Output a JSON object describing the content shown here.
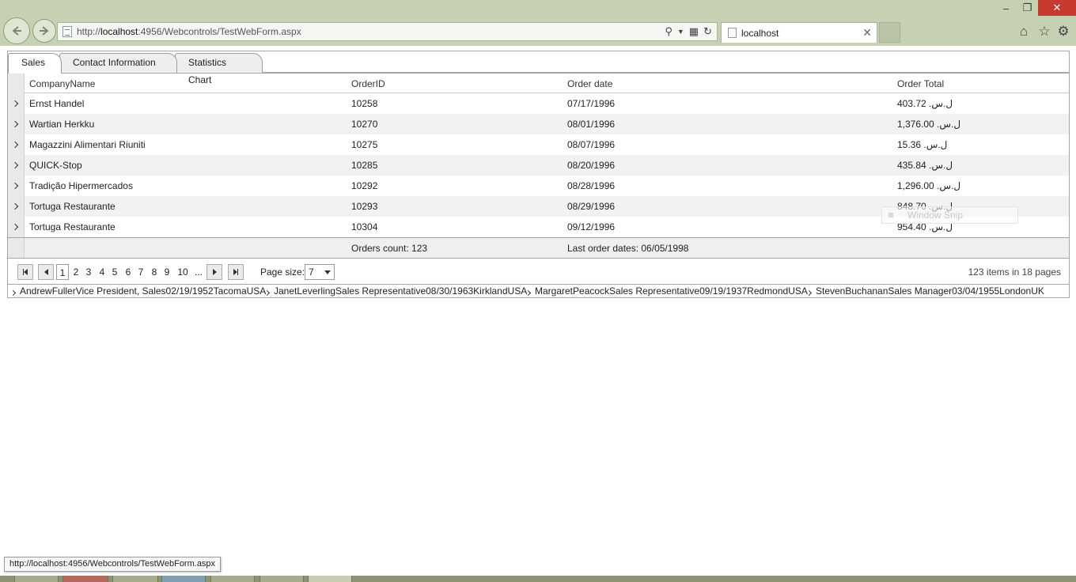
{
  "browser": {
    "url_prefix": "http://",
    "url_host": "localhost",
    "url_rest": ":4956/Webcontrols/TestWebForm.aspx",
    "tab_title": "localhost",
    "status_url": "http://localhost:4956/Webcontrols/TestWebForm.aspx"
  },
  "tabs": [
    {
      "label": "Sales",
      "active": true
    },
    {
      "label": "Contact Information",
      "active": false
    },
    {
      "label": "Statistics Chart",
      "active": false
    }
  ],
  "grid": {
    "columns": [
      "CompanyName",
      "OrderID",
      "Order date",
      "Order Total"
    ],
    "rows": [
      {
        "company": "Ernst Handel",
        "order_id": "10258",
        "date": "07/17/1996",
        "total": "403.72 .ل.س"
      },
      {
        "company": "Wartian Herkku",
        "order_id": "10270",
        "date": "08/01/1996",
        "total": "1,376.00 .ل.س"
      },
      {
        "company": "Magazzini Alimentari Riuniti",
        "order_id": "10275",
        "date": "08/07/1996",
        "total": "15.36 .ل.س"
      },
      {
        "company": "QUICK-Stop",
        "order_id": "10285",
        "date": "08/20/1996",
        "total": "435.84 .ل.س"
      },
      {
        "company": "Tradição Hipermercados",
        "order_id": "10292",
        "date": "08/28/1996",
        "total": "1,296.00 .ل.س"
      },
      {
        "company": "Tortuga Restaurante",
        "order_id": "10293",
        "date": "08/29/1996",
        "total": "848.70 .ل.س"
      },
      {
        "company": "Tortuga Restaurante",
        "order_id": "10304",
        "date": "09/12/1996",
        "total": "954.40 .ل.س"
      }
    ],
    "footer": {
      "orders_count": "Orders count: 123",
      "last_order": "Last order dates: 06/05/1998"
    }
  },
  "pager": {
    "pages": [
      "1",
      "2",
      "3",
      "4",
      "5",
      "6",
      "7",
      "8",
      "9",
      "10",
      "..."
    ],
    "current_page": "1",
    "page_size_label": "Page size:",
    "page_size_value": "7",
    "info": "123 items in 18 pages"
  },
  "employees": [
    "AndrewFullerVice President, Sales02/19/1952TacomaUSA",
    "JanetLeverlingSales Representative08/30/1963KirklandUSA",
    "MargaretPeacockSales Representative09/19/1937RedmondUSA",
    "StevenBuchananSales Manager03/04/1955LondonUK"
  ],
  "watermark": "Window Snip"
}
